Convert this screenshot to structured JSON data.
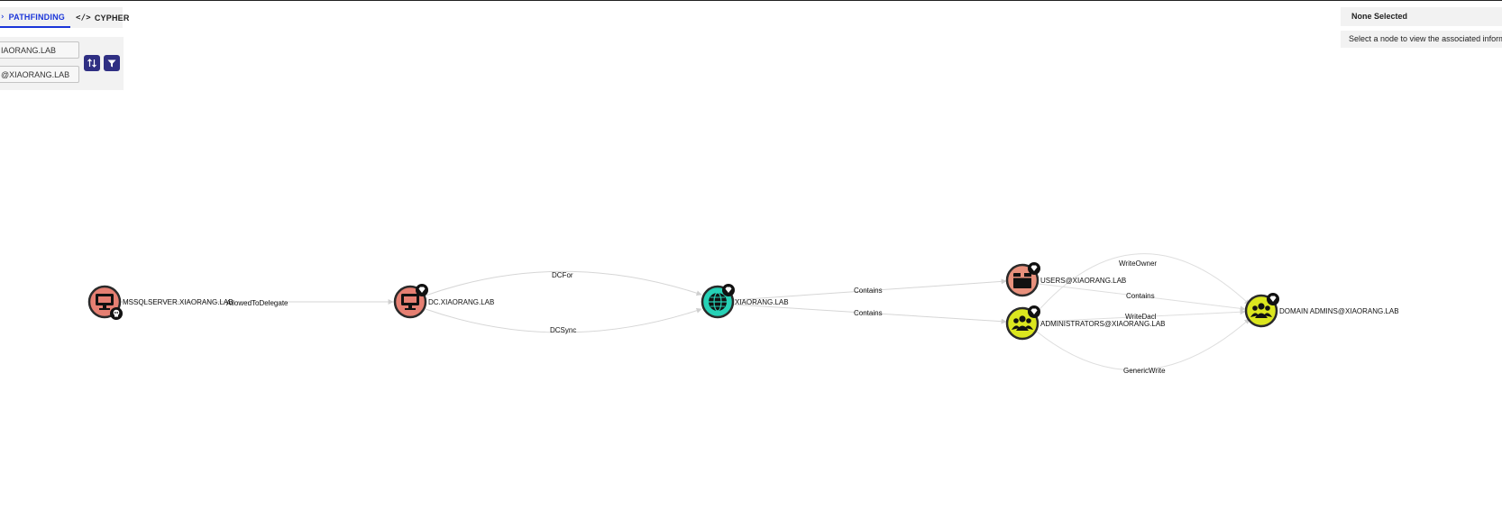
{
  "tabs": {
    "pathfinding_label": "PATHFINDING",
    "cypher_label": "CYPHER"
  },
  "search": {
    "start_value": "IAORANG.LAB",
    "end_value": "@XIAORANG.LAB"
  },
  "info_panel": {
    "title": "None Selected",
    "message": "Select a node to view the associated informa"
  },
  "colors": {
    "accent": "#1a35d9",
    "button": "#2f2f83",
    "computer": "#e57f72",
    "domain": "#26d1b6",
    "group": "#dbe61f"
  },
  "nodes": [
    {
      "label": "MSSQLSERVER.XIAORANG.LAB",
      "type": "computer",
      "badge": "skull-icon"
    },
    {
      "label": "DC.XIAORANG.LAB",
      "type": "computer",
      "badge": "gem-icon"
    },
    {
      "label": "XIAORANG.LAB",
      "type": "domain",
      "badge": "gem-icon"
    },
    {
      "label": "USERS@XIAORANG.LAB",
      "type": "container",
      "badge": "gem-icon"
    },
    {
      "label": "ADMINISTRATORS@XIAORANG.LAB",
      "type": "group",
      "badge": "gem-icon"
    },
    {
      "label": "DOMAIN ADMINS@XIAORANG.LAB",
      "type": "group",
      "badge": "gem-icon"
    }
  ],
  "edges": [
    {
      "label": "AllowedToDelegate",
      "from": "MSSQLSERVER.XIAORANG.LAB",
      "to": "DC.XIAORANG.LAB"
    },
    {
      "label": "DCFor",
      "from": "DC.XIAORANG.LAB",
      "to": "XIAORANG.LAB"
    },
    {
      "label": "DCSync",
      "from": "DC.XIAORANG.LAB",
      "to": "XIAORANG.LAB"
    },
    {
      "label": "Contains",
      "from": "XIAORANG.LAB",
      "to": "USERS@XIAORANG.LAB"
    },
    {
      "label": "Contains",
      "from": "XIAORANG.LAB",
      "to": "ADMINISTRATORS@XIAORANG.LAB"
    },
    {
      "label": "WriteOwner",
      "from": "ADMINISTRATORS@XIAORANG.LAB",
      "to": "DOMAIN ADMINS@XIAORANG.LAB"
    },
    {
      "label": "Contains",
      "from": "USERS@XIAORANG.LAB",
      "to": "DOMAIN ADMINS@XIAORANG.LAB"
    },
    {
      "label": "WriteDacl",
      "from": "ADMINISTRATORS@XIAORANG.LAB",
      "to": "DOMAIN ADMINS@XIAORANG.LAB"
    },
    {
      "label": "GenericWrite",
      "from": "ADMINISTRATORS@XIAORANG.LAB",
      "to": "DOMAIN ADMINS@XIAORANG.LAB"
    }
  ]
}
